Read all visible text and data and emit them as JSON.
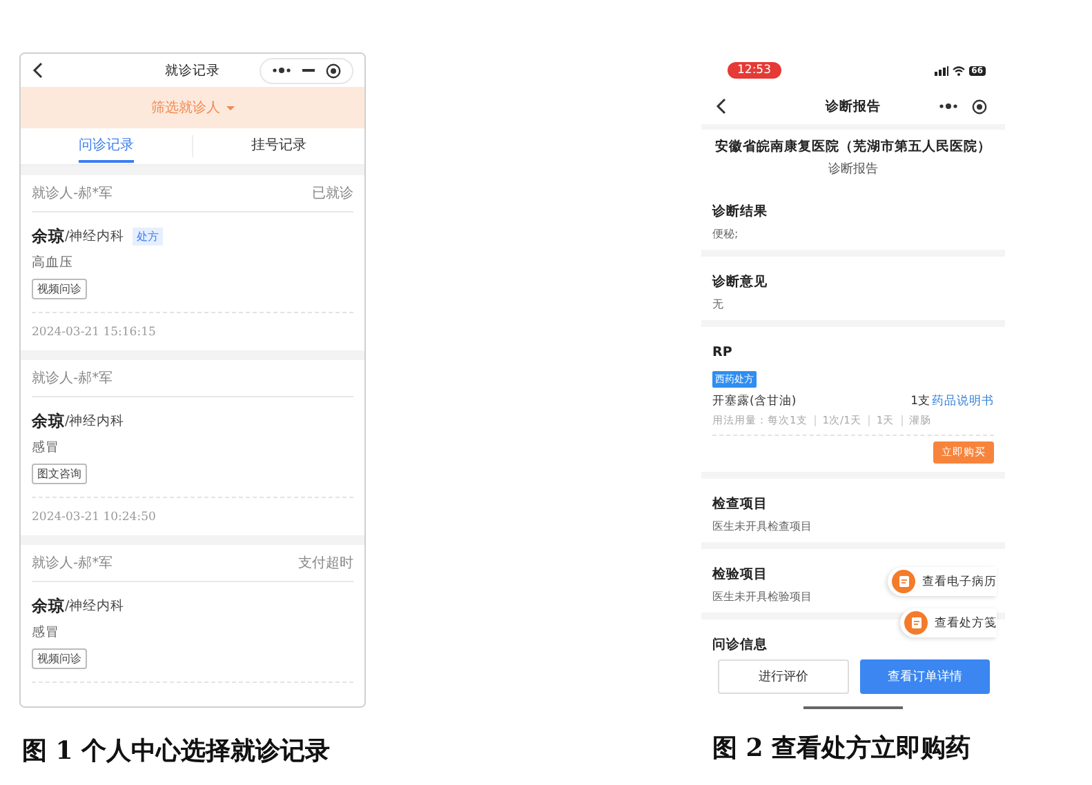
{
  "figure_1": {
    "caption": "图 1 个人中心选择就诊记录",
    "screen": {
      "title": "就诊记录",
      "filter": "筛选就诊人",
      "tabs": [
        {
          "label": "问诊记录",
          "selected": true
        },
        {
          "label": "挂号记录",
          "selected": false
        }
      ],
      "records": [
        {
          "patient": "就诊人-郝*军",
          "status": "已就诊",
          "doctor": "余琼",
          "department": "/神经内科",
          "badge": "处方",
          "diagnosis": "高血压",
          "consult_type": "视频问诊",
          "time": "2024-03-21 15:16:15"
        },
        {
          "patient": "就诊人-郝*军",
          "doctor": "余琼",
          "department": "/神经内科",
          "diagnosis": "感冒",
          "consult_type": "图文咨询",
          "time": "2024-03-21 10:24:50"
        },
        {
          "patient": "就诊人-郝*军",
          "status": "支付超时",
          "doctor": "余琼",
          "department": "/神经内科",
          "diagnosis": "感冒",
          "consult_type": "视频问诊"
        }
      ]
    }
  },
  "figure_2": {
    "caption": "图 2 查看处方立即购药",
    "screen": {
      "status_time": "12:53",
      "battery": "66",
      "title": "诊断报告",
      "hospital": "安徽省皖南康复医院（芜湖市第五人民医院）",
      "subtitle": "诊断报告",
      "sections": [
        {
          "kind": "text",
          "heading": "诊断结果",
          "text": "便秘;"
        },
        {
          "kind": "text",
          "heading": "诊断意见",
          "text": "无"
        },
        {
          "kind": "prescription",
          "heading": "RP",
          "tag": "西药处方",
          "drug": "开塞露(含甘油)",
          "quantity": "1支",
          "link": "药品说明书",
          "usage": [
            "用法用量：每次1支",
            "1次/1天",
            "1天",
            "灌肠"
          ],
          "buy_button": "立即购买"
        },
        {
          "kind": "text",
          "heading": "检查项目",
          "text": "医生未开具检查项目"
        },
        {
          "kind": "text",
          "heading": "检验项目",
          "text": "医生未开具检验项目"
        },
        {
          "kind": "heading",
          "heading": "问诊信息"
        }
      ],
      "floating_buttons": [
        "查看电子病历",
        "查看处方笺"
      ],
      "bottom_buttons": [
        {
          "label": "进行评价",
          "primary": false
        },
        {
          "label": "查看订单详情",
          "primary": true
        }
      ]
    }
  }
}
